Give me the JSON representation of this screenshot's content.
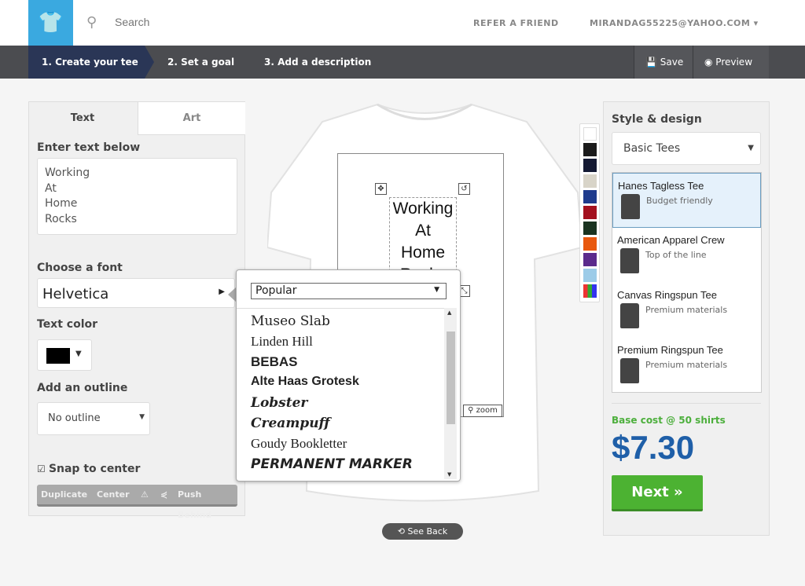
{
  "header": {
    "search_placeholder": "Search",
    "refer": "REFER A FRIEND",
    "email": "MIRANDAG55225@YAHOO.COM ▾"
  },
  "steps": [
    "1. Create your tee",
    "2. Set a goal",
    "3. Add a description"
  ],
  "actions": {
    "save": "Save",
    "preview": "Preview"
  },
  "left": {
    "tabs": [
      "Text",
      "Art"
    ],
    "enter_text_label": "Enter text below",
    "text_value": "Working\nAt\nHome\nRocks",
    "font_label": "Choose a font",
    "font_value": "Helvetica",
    "color_label": "Text color",
    "text_color": "#000000",
    "outline_label": "Add an outline",
    "outline_value": "No outline",
    "snap_label": "Snap to center",
    "snap_checked": true,
    "toolbar": {
      "duplicate": "Duplicate",
      "center": "Center",
      "push_behind": "Push Behind"
    }
  },
  "font_popup": {
    "category": "Popular",
    "fonts": [
      "Museo Slab",
      "Linden Hill",
      "BEBAS",
      "Alte Haas Grotesk",
      "Lobster",
      "Creampuff",
      "Goudy Bookletter",
      "Permanent Marker"
    ]
  },
  "canvas": {
    "design_text": [
      "Working",
      "At",
      "Home",
      "Rocks"
    ],
    "zoom": "zoom",
    "see_back": "See Back"
  },
  "palette": [
    "#ffffff",
    "#1a1a1a",
    "#141a33",
    "#d8d4c8",
    "#1e3a8c",
    "#a3101e",
    "#1a3320",
    "#e8580e",
    "#5a2a8c",
    "#9ccbe8"
  ],
  "right": {
    "title": "Style & design",
    "style_value": "Basic Tees",
    "products": [
      {
        "name": "Hanes Tagless Tee",
        "desc": "Budget friendly",
        "selected": true
      },
      {
        "name": "American Apparel Crew",
        "desc": "Top of the line"
      },
      {
        "name": "Canvas Ringspun Tee",
        "desc": "Premium materials"
      },
      {
        "name": "Premium Ringspun Tee",
        "desc": "Premium materials"
      }
    ],
    "base_cost": "Base cost @ 50 shirts",
    "price": "$7.30",
    "next": "Next »"
  }
}
